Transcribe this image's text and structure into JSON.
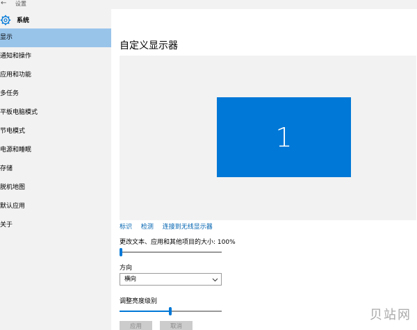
{
  "topbar": {
    "title": "设置"
  },
  "sidebar": {
    "section_title": "系统",
    "items": [
      {
        "label": "显示",
        "active": true
      },
      {
        "label": "通知和操作"
      },
      {
        "label": "应用和功能"
      },
      {
        "label": "多任务"
      },
      {
        "label": "平板电脑模式"
      },
      {
        "label": "节电模式"
      },
      {
        "label": "电源和睡眠"
      },
      {
        "label": "存储"
      },
      {
        "label": "脱机地图"
      },
      {
        "label": "默认应用"
      },
      {
        "label": "关于"
      }
    ]
  },
  "main": {
    "title": "自定义显示器",
    "monitor_number": "1",
    "links": {
      "identify": "标识",
      "detect": "检测",
      "connect": "连接到无线显示器"
    },
    "scale": {
      "label": "更改文本、应用和其他项目的大小: 100%",
      "value": 0
    },
    "orientation": {
      "label": "方向",
      "value": "横向"
    },
    "brightness": {
      "label": "调整亮度级别",
      "value": 0.5
    },
    "buttons": {
      "apply": "应用",
      "cancel": "取消"
    }
  },
  "watermark": "贝站网",
  "colors": {
    "accent": "#0078d7",
    "selected": "#99c4ea",
    "link": "#0063b1"
  },
  "icons": {
    "back": "back-arrow-icon",
    "system": "gear-icon",
    "dropdown": "chevron-down-icon"
  }
}
